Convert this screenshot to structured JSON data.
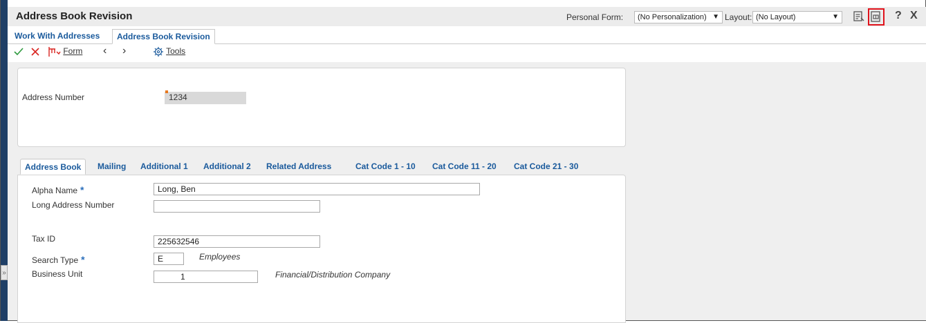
{
  "header": {
    "title": "Address Book Revision",
    "personal_form_label": "Personal Form:",
    "personal_form_value": "(No Personalization)",
    "layout_label": "Layout:",
    "layout_value": "(No Layout)",
    "icons": [
      "notes-icon",
      "export-icon",
      "help-icon",
      "close-icon"
    ],
    "help_glyph": "?",
    "close_glyph": "X"
  },
  "form_tabs": [
    {
      "label": "Work With Addresses",
      "active": false
    },
    {
      "label": "Address Book Revision",
      "active": true
    }
  ],
  "toolbar": {
    "ok_icon": "checkmark-icon",
    "cancel_icon": "x-icon",
    "form_label": "Form",
    "tools_label": "Tools"
  },
  "header_section": {
    "address_number_label": "Address Number",
    "address_number_value": "1234"
  },
  "sub_tabs": [
    {
      "label": "Address Book",
      "active": true
    },
    {
      "label": "Mailing",
      "active": false
    },
    {
      "label": "Additional 1",
      "active": false
    },
    {
      "label": "Additional 2",
      "active": false
    },
    {
      "label": "Related Address",
      "active": false
    },
    {
      "label": "Cat Code 1 - 10",
      "active": false
    },
    {
      "label": "Cat Code 11 - 20",
      "active": false
    },
    {
      "label": "Cat Code 21 - 30",
      "active": false
    }
  ],
  "fields": {
    "alpha_name_label": "Alpha Name",
    "alpha_name_value": "Long, Ben",
    "long_address_label": "Long Address Number",
    "long_address_value": "",
    "tax_id_label": "Tax ID",
    "tax_id_value": "225632546",
    "search_type_label": "Search Type",
    "search_type_value": "E",
    "search_type_desc": "Employees",
    "business_unit_label": "Business Unit",
    "business_unit_value": "1",
    "business_unit_desc": "Financial/Distribution Company",
    "required_marker": "*"
  },
  "colors": {
    "accent": "#1a5a9c",
    "rail": "#1f3f66",
    "ok_green": "#2e9a3e",
    "cancel_red": "#d9231f",
    "highlight_red": "#e0121b",
    "required_blue": "#2a6ebb",
    "field_marker": "#e8781e"
  }
}
